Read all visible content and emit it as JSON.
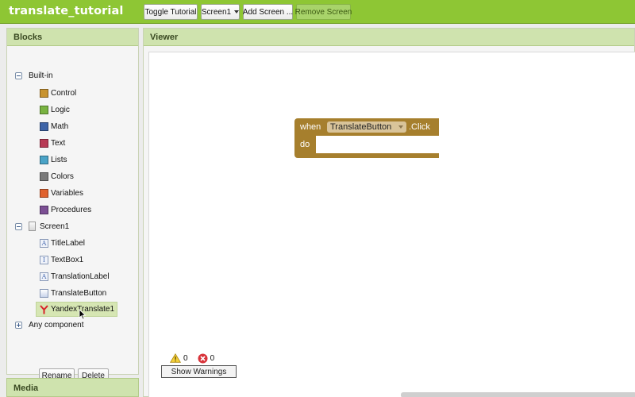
{
  "header": {
    "app_title": "translate_tutorial",
    "toggle_tutorial": "Toggle Tutorial",
    "screen_select": "Screen1",
    "add_screen": "Add Screen ...",
    "remove_screen": "Remove Screen"
  },
  "blocks_panel": {
    "title": "Blocks",
    "builtin": {
      "label": "Built-in",
      "items": [
        {
          "label": "Control",
          "color": "#c8932e"
        },
        {
          "label": "Logic",
          "color": "#79b341"
        },
        {
          "label": "Math",
          "color": "#3e64a8"
        },
        {
          "label": "Text",
          "color": "#b83a55"
        },
        {
          "label": "Lists",
          "color": "#4aa3c7"
        },
        {
          "label": "Colors",
          "color": "#7a7a7a"
        },
        {
          "label": "Variables",
          "color": "#e0622f"
        },
        {
          "label": "Procedures",
          "color": "#7c4f94"
        }
      ]
    },
    "screen": {
      "label": "Screen1",
      "components": [
        {
          "label": "TitleLabel",
          "icon": "label-icon"
        },
        {
          "label": "TextBox1",
          "icon": "textbox-icon"
        },
        {
          "label": "TranslationLabel",
          "icon": "label-icon"
        },
        {
          "label": "TranslateButton",
          "icon": "button-icon"
        },
        {
          "label": "YandexTranslate1",
          "icon": "yandex-translate-icon"
        }
      ]
    },
    "any_component": "Any component",
    "rename_button": "Rename",
    "delete_button": "Delete"
  },
  "media_panel": {
    "title": "Media"
  },
  "viewer": {
    "title": "Viewer",
    "event_block": {
      "when": "when",
      "component": "TranslateButton",
      "event": ".Click",
      "do": "do",
      "color": "#a67f2d"
    },
    "warnings": {
      "warning_count": "0",
      "error_count": "0",
      "show_warnings": "Show Warnings"
    }
  }
}
